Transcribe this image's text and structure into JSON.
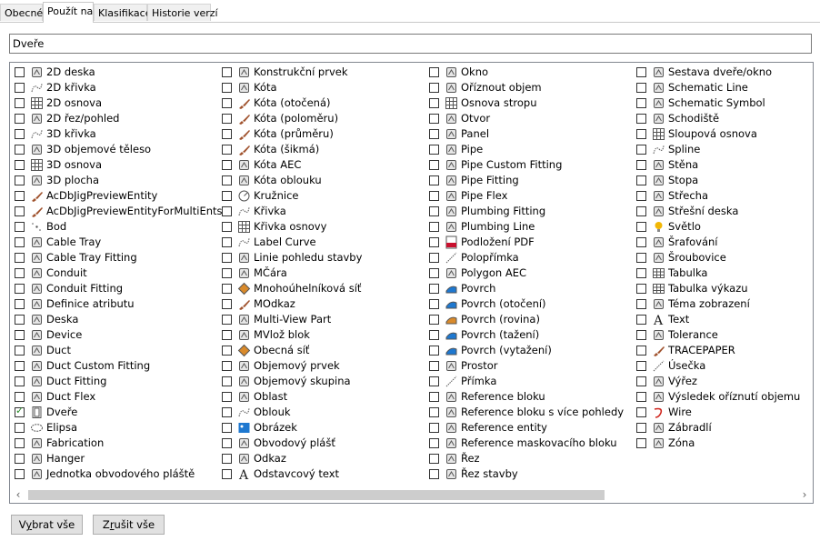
{
  "tabs": [
    {
      "label": "Obecné",
      "active": false
    },
    {
      "label": "Použít na",
      "active": true
    },
    {
      "label": "Klasifikace",
      "active": false
    },
    {
      "label": "Historie verzí",
      "active": false
    }
  ],
  "filter": {
    "value": "Dveře"
  },
  "columns": [
    [
      {
        "label": "2D deska",
        "icon": "2d-slab-icon"
      },
      {
        "label": "2D křivka",
        "icon": "2d-curve-icon"
      },
      {
        "label": "2D osnova",
        "icon": "2d-grid-icon"
      },
      {
        "label": "2D řez/pohled",
        "icon": "2d-section-icon"
      },
      {
        "label": "3D křivka",
        "icon": "3d-curve-icon"
      },
      {
        "label": "3D objemové těleso",
        "icon": "3d-solid-icon"
      },
      {
        "label": "3D osnova",
        "icon": "3d-grid-icon"
      },
      {
        "label": "3D plocha",
        "icon": "3d-face-icon"
      },
      {
        "label": "AcDbJigPreviewEntity",
        "icon": "brush-icon"
      },
      {
        "label": "AcDbJigPreviewEntityForMultiEnts",
        "icon": "brush-icon"
      },
      {
        "label": "Bod",
        "icon": "point-icon"
      },
      {
        "label": "Cable Tray",
        "icon": "cable-tray-icon"
      },
      {
        "label": "Cable Tray Fitting",
        "icon": "cable-tray-fitting-icon"
      },
      {
        "label": "Conduit",
        "icon": "conduit-icon"
      },
      {
        "label": "Conduit Fitting",
        "icon": "conduit-fitting-icon"
      },
      {
        "label": "Definice atributu",
        "icon": "attribute-icon"
      },
      {
        "label": "Deska",
        "icon": "slab-icon"
      },
      {
        "label": "Device",
        "icon": "device-icon"
      },
      {
        "label": "Duct",
        "icon": "duct-icon"
      },
      {
        "label": "Duct Custom Fitting",
        "icon": "duct-custom-fitting-icon"
      },
      {
        "label": "Duct Fitting",
        "icon": "duct-fitting-icon"
      },
      {
        "label": "Duct Flex",
        "icon": "duct-flex-icon"
      },
      {
        "label": "Dveře",
        "icon": "door-icon",
        "checked": true
      },
      {
        "label": "Elipsa",
        "icon": "ellipse-icon"
      },
      {
        "label": "Fabrication",
        "icon": "fabrication-icon"
      },
      {
        "label": "Hanger",
        "icon": "hanger-icon"
      },
      {
        "label": "Jednotka obvodového pláště",
        "icon": "curtain-wall-unit-icon"
      }
    ],
    [
      {
        "label": "Konstrukční prvek",
        "icon": "structural-member-icon"
      },
      {
        "label": "Kóta",
        "icon": "dimension-icon"
      },
      {
        "label": "Kóta (otočená)",
        "icon": "brush-icon"
      },
      {
        "label": "Kóta (poloměru)",
        "icon": "brush-icon"
      },
      {
        "label": "Kóta (průměru)",
        "icon": "brush-icon"
      },
      {
        "label": "Kóta (šikmá)",
        "icon": "brush-icon"
      },
      {
        "label": "Kóta AEC",
        "icon": "aec-dimension-icon"
      },
      {
        "label": "Kóta oblouku",
        "icon": "arc-dimension-icon"
      },
      {
        "label": "Kružnice",
        "icon": "circle-icon"
      },
      {
        "label": "Křivka",
        "icon": "curve-icon"
      },
      {
        "label": "Křivka osnovy",
        "icon": "grid-curve-icon"
      },
      {
        "label": "Label Curve",
        "icon": "label-curve-icon"
      },
      {
        "label": "Linie pohledu stavby",
        "icon": "building-elevation-line-icon"
      },
      {
        "label": "MČára",
        "icon": "mline-icon"
      },
      {
        "label": "Mnohoúhelníková síť",
        "icon": "polyface-mesh-icon"
      },
      {
        "label": "MOdkaz",
        "icon": "brush-icon"
      },
      {
        "label": "Multi-View Part",
        "icon": "multi-view-part-icon"
      },
      {
        "label": "MVlož blok",
        "icon": "minsert-block-icon"
      },
      {
        "label": "Obecná síť",
        "icon": "mesh-icon"
      },
      {
        "label": "Objemový prvek",
        "icon": "mass-element-icon"
      },
      {
        "label": "Objemový skupina",
        "icon": "mass-group-icon"
      },
      {
        "label": "Oblast",
        "icon": "region-icon"
      },
      {
        "label": "Oblouk",
        "icon": "arc-icon"
      },
      {
        "label": "Obrázek",
        "icon": "image-icon"
      },
      {
        "label": "Obvodový plášť",
        "icon": "curtain-wall-icon"
      },
      {
        "label": "Odkaz",
        "icon": "leader-icon"
      },
      {
        "label": "Odstavcový text",
        "icon": "mtext-icon"
      }
    ],
    [
      {
        "label": "Okno",
        "icon": "window-icon"
      },
      {
        "label": "Oříznout objem",
        "icon": "clip-volume-icon"
      },
      {
        "label": "Osnova stropu",
        "icon": "ceiling-grid-icon"
      },
      {
        "label": "Otvor",
        "icon": "opening-icon"
      },
      {
        "label": "Panel",
        "icon": "panel-icon"
      },
      {
        "label": "Pipe",
        "icon": "pipe-icon"
      },
      {
        "label": "Pipe Custom Fitting",
        "icon": "pipe-custom-fitting-icon"
      },
      {
        "label": "Pipe Fitting",
        "icon": "pipe-fitting-icon"
      },
      {
        "label": "Pipe Flex",
        "icon": "pipe-flex-icon"
      },
      {
        "label": "Plumbing Fitting",
        "icon": "plumbing-fitting-icon"
      },
      {
        "label": "Plumbing Line",
        "icon": "plumbing-line-icon"
      },
      {
        "label": "Podložení PDF",
        "icon": "pdf-underlay-icon"
      },
      {
        "label": "Polopřímka",
        "icon": "ray-icon"
      },
      {
        "label": "Polygon AEC",
        "icon": "aec-polygon-icon"
      },
      {
        "label": "Povrch",
        "icon": "surface-icon"
      },
      {
        "label": "Povrch (otočení)",
        "icon": "revolved-surface-icon"
      },
      {
        "label": "Povrch (rovina)",
        "icon": "planar-surface-icon"
      },
      {
        "label": "Povrch (tažení)",
        "icon": "swept-surface-icon"
      },
      {
        "label": "Povrch (vytažení)",
        "icon": "extruded-surface-icon"
      },
      {
        "label": "Prostor",
        "icon": "space-icon"
      },
      {
        "label": "Přímka",
        "icon": "xline-icon"
      },
      {
        "label": "Reference bloku",
        "icon": "block-reference-icon"
      },
      {
        "label": "Reference bloku s více pohledy",
        "icon": "multi-view-block-icon"
      },
      {
        "label": "Reference entity",
        "icon": "entity-reference-icon"
      },
      {
        "label": "Reference maskovacího bloku",
        "icon": "mask-block-icon"
      },
      {
        "label": "Řez",
        "icon": "section-icon"
      },
      {
        "label": "Řez stavby",
        "icon": "building-section-icon"
      }
    ],
    [
      {
        "label": "Sestava dveře/okno",
        "icon": "door-window-assembly-icon"
      },
      {
        "label": "Schematic Line",
        "icon": "schematic-line-icon"
      },
      {
        "label": "Schematic Symbol",
        "icon": "schematic-symbol-icon"
      },
      {
        "label": "Schodiště",
        "icon": "stair-icon"
      },
      {
        "label": "Sloupová osnova",
        "icon": "column-grid-icon"
      },
      {
        "label": "Spline",
        "icon": "spline-icon"
      },
      {
        "label": "Stěna",
        "icon": "wall-icon"
      },
      {
        "label": "Stopa",
        "icon": "trace-icon"
      },
      {
        "label": "Střecha",
        "icon": "roof-icon"
      },
      {
        "label": "Střešní deska",
        "icon": "roof-slab-icon"
      },
      {
        "label": "Světlo",
        "icon": "light-icon"
      },
      {
        "label": "Šrafování",
        "icon": "hatch-icon"
      },
      {
        "label": "Šroubovice",
        "icon": "helix-icon"
      },
      {
        "label": "Tabulka",
        "icon": "table-icon"
      },
      {
        "label": "Tabulka výkazu",
        "icon": "schedule-table-icon"
      },
      {
        "label": "Téma zobrazení",
        "icon": "display-theme-icon"
      },
      {
        "label": "Text",
        "icon": "text-icon"
      },
      {
        "label": "Tolerance",
        "icon": "tolerance-icon"
      },
      {
        "label": "TRACEPAPER",
        "icon": "brush-icon"
      },
      {
        "label": "Úsečka",
        "icon": "line-icon"
      },
      {
        "label": "Výřez",
        "icon": "viewport-icon"
      },
      {
        "label": "Výsledek oříznutí objemu",
        "icon": "clip-volume-result-icon"
      },
      {
        "label": "Wire",
        "icon": "wire-icon"
      },
      {
        "label": "Zábradlí",
        "icon": "railing-icon"
      },
      {
        "label": "Zóna",
        "icon": "zone-icon"
      }
    ]
  ],
  "scrollbar": {
    "left_arrow": "‹",
    "right_arrow": "›"
  },
  "buttons": {
    "select_all_prefix": "V",
    "select_all_mnemonic": "y",
    "select_all_suffix": "brat vše",
    "clear_all_prefix": "Z",
    "clear_all_mnemonic": "r",
    "clear_all_suffix": "ušit vše"
  },
  "colors": {
    "checked": "#2a8a2a",
    "brush": "#a0522d",
    "blue": "#1e78d0",
    "pdf": "#c8102e",
    "light": "#f2b705",
    "wire": "#d0261e",
    "orange": "#d98a2b"
  }
}
